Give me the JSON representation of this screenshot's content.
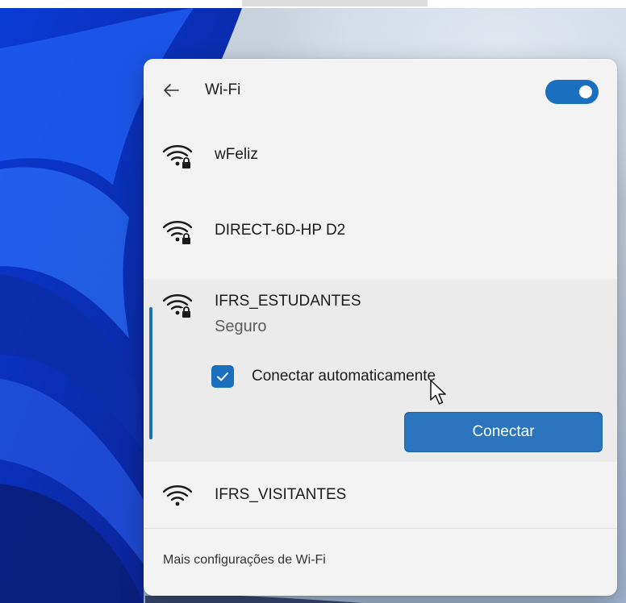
{
  "panel": {
    "title": "Wi-Fi",
    "wifi_enabled": true
  },
  "networks": [
    {
      "name": "wFeliz",
      "secured": true
    },
    {
      "name": "DIRECT-6D-HP D2",
      "secured": true
    },
    {
      "name": "IFRS_ESTUDANTES",
      "secured": true,
      "status": "Seguro",
      "selected": true
    },
    {
      "name": "IFRS_VISITANTES",
      "secured": false
    }
  ],
  "selected_network": {
    "auto_connect_label": "Conectar automaticamente",
    "auto_connect_checked": true,
    "connect_label": "Conectar"
  },
  "footer": {
    "more_settings_label": "Mais configurações de Wi-Fi"
  },
  "colors": {
    "accent": "#1a6fbf",
    "panel_bg": "#f3f3f3",
    "selected_bg": "#ebebeb"
  },
  "icons": {
    "back": "arrow-left-icon",
    "wifi_secured": "wifi-lock-icon",
    "wifi_open": "wifi-icon",
    "check": "checkmark-icon"
  }
}
